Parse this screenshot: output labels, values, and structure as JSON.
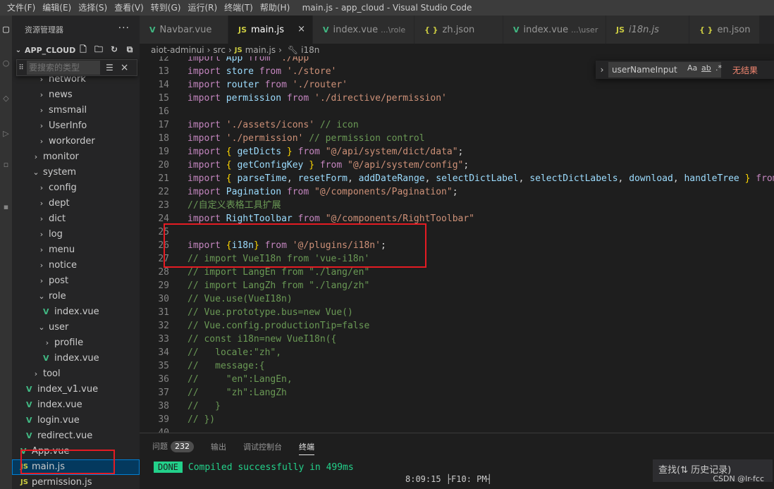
{
  "menu": [
    "文件(F)",
    "编辑(E)",
    "选择(S)",
    "查看(V)",
    "转到(G)",
    "运行(R)",
    "终端(T)",
    "帮助(H)"
  ],
  "window_title": "main.js - app_cloud - Visual Studio Code",
  "sidebar": {
    "header": "资源管理器",
    "more": "···",
    "section": "APP_CLOUD",
    "filter_placeholder": "要搜索的类型",
    "tree": [
      {
        "label": "network",
        "type": "folder"
      },
      {
        "label": "news",
        "type": "folder"
      },
      {
        "label": "smsmail",
        "type": "folder"
      },
      {
        "label": "UserInfo",
        "type": "folder"
      },
      {
        "label": "workorder",
        "type": "folder"
      },
      {
        "label": "monitor",
        "type": "folder"
      },
      {
        "label": "system",
        "type": "folder-open"
      },
      {
        "label": "config",
        "type": "folder"
      },
      {
        "label": "dept",
        "type": "folder"
      },
      {
        "label": "dict",
        "type": "folder"
      },
      {
        "label": "log",
        "type": "folder"
      },
      {
        "label": "menu",
        "type": "folder"
      },
      {
        "label": "notice",
        "type": "folder"
      },
      {
        "label": "post",
        "type": "folder"
      },
      {
        "label": "role",
        "type": "folder-open"
      },
      {
        "label": "index.vue",
        "type": "vue"
      },
      {
        "label": "user",
        "type": "folder-open"
      },
      {
        "label": "profile",
        "type": "folder"
      },
      {
        "label": "index.vue",
        "type": "vue"
      },
      {
        "label": "tool",
        "type": "folder"
      },
      {
        "label": "index_v1.vue",
        "type": "vue"
      },
      {
        "label": "index.vue",
        "type": "vue"
      },
      {
        "label": "login.vue",
        "type": "vue"
      },
      {
        "label": "redirect.vue",
        "type": "vue"
      },
      {
        "label": "App.vue",
        "type": "vue"
      },
      {
        "label": "main.js",
        "type": "js"
      },
      {
        "label": "permission.js",
        "type": "js"
      }
    ]
  },
  "tabs": [
    {
      "label": "Navbar.vue",
      "type": "vue",
      "desc": ""
    },
    {
      "label": "main.js",
      "type": "js",
      "desc": "",
      "close": "×"
    },
    {
      "label": "index.vue",
      "type": "vue",
      "desc": "...\\role"
    },
    {
      "label": "zh.json",
      "type": "json",
      "desc": ""
    },
    {
      "label": "index.vue",
      "type": "vue",
      "desc": "...\\user"
    },
    {
      "label": "i18n.js",
      "type": "js",
      "desc": ""
    },
    {
      "label": "en.json",
      "type": "json",
      "desc": ""
    }
  ],
  "breadcrumb": [
    "aiot-adminui",
    "src",
    "main.js",
    "i18n"
  ],
  "icons": {
    "vue": "V",
    "js": "JS",
    "json": "{ }",
    "chevron": "›",
    "close": "×",
    "filter": "☰"
  },
  "code": [
    {
      "n": "12",
      "t": "import App from './App'"
    },
    {
      "n": "13",
      "t": "import store from './store'"
    },
    {
      "n": "14",
      "t": "import router from './router'"
    },
    {
      "n": "15",
      "t": "import permission from './directive/permission'"
    },
    {
      "n": "16",
      "t": ""
    },
    {
      "n": "17",
      "t": "import './assets/icons' // icon"
    },
    {
      "n": "18",
      "t": "import './permission' // permission control"
    },
    {
      "n": "19",
      "t": "import { getDicts } from \"@/api/system/dict/data\";"
    },
    {
      "n": "20",
      "t": "import { getConfigKey } from \"@/api/system/config\";"
    },
    {
      "n": "21",
      "t": "import { parseTime, resetForm, addDateRange, selectDictLabel, selectDictLabels, download, handleTree } from"
    },
    {
      "n": "22",
      "t": "import Pagination from \"@/components/Pagination\";"
    },
    {
      "n": "23",
      "t": "//自定义表格工具扩展"
    },
    {
      "n": "24",
      "t": "import RightToolbar from \"@/components/RightToolbar\""
    },
    {
      "n": "25",
      "t": ""
    },
    {
      "n": "26",
      "t": "import {i18n} from '@/plugins/i18n';"
    },
    {
      "n": "27",
      "t": "// import VueI18n from 'vue-i18n'"
    },
    {
      "n": "28",
      "t": "// import LangEn from \"./lang/en\""
    },
    {
      "n": "29",
      "t": "// import LangZh from \"./lang/zh\""
    },
    {
      "n": "30",
      "t": "// Vue.use(VueI18n)"
    },
    {
      "n": "31",
      "t": "// Vue.prototype.bus=new Vue()"
    },
    {
      "n": "32",
      "t": "// Vue.config.productionTip=false"
    },
    {
      "n": "33",
      "t": "// const i18n=new VueI18n({"
    },
    {
      "n": "34",
      "t": "//   locale:\"zh\","
    },
    {
      "n": "35",
      "t": "//   message:{"
    },
    {
      "n": "36",
      "t": "//     \"en\":LangEn,"
    },
    {
      "n": "37",
      "t": "//     \"zh\":LangZh"
    },
    {
      "n": "38",
      "t": "//   }"
    },
    {
      "n": "39",
      "t": "// })"
    },
    {
      "n": "40",
      "t": ""
    }
  ],
  "find": {
    "value": "userNameInput",
    "opt_case": "Aa",
    "opt_word": "ab",
    "opt_regex": ".*",
    "result": "无结果"
  },
  "panel": {
    "tabs": [
      "问题",
      "输出",
      "调试控制台",
      "终端"
    ],
    "problems_count": "232",
    "done_badge": "DONE",
    "done_msg": "Compiled successfully in 499ms",
    "time": "8:09:15 ├F10: PM┤",
    "history_tip": "查找(⇅ 历史记录)"
  },
  "watermark": "CSDN @lr-fcc",
  "colors": {
    "accent": "#007fd4",
    "highlight_box": "#e51b23",
    "vue": "#41b883",
    "js": "#cbcb41",
    "done": "#23d18b",
    "no_result": "#f48771"
  }
}
